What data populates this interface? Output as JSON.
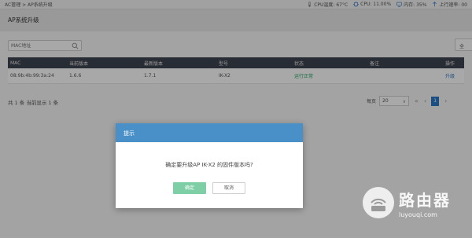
{
  "topbar": {
    "breadcrumb": "AC管理 > AP系统升级",
    "cpu_temp": "CPU温度: 67°C",
    "cpu_usage": "CPU: 11.00%",
    "memory": "内存: 35%",
    "uplink": "上行速率: 00"
  },
  "page": {
    "title": "AP系统升级"
  },
  "search": {
    "placeholder": "MAC地址"
  },
  "panel": {
    "right_button": "全"
  },
  "table": {
    "headers": [
      "MAC",
      "当前版本",
      "最新版本",
      "型号",
      "状态",
      "备注",
      "操作"
    ],
    "rows": [
      {
        "mac": "08:9b:4b:99:3a:24",
        "current": "1.6.6",
        "latest": "1.7.1",
        "model": "IK-X2",
        "status": "运行正常",
        "remark": "",
        "action": "升级"
      }
    ]
  },
  "footer": {
    "summary": "共 1 条 当前显示 1 条",
    "per_page_label": "每页",
    "per_page_value": "20",
    "current_page": "1"
  },
  "dialog": {
    "title": "提示",
    "message": "确定要升级AP IK-X2 的固件版本吗?",
    "ok_label": "确定",
    "cancel_label": "取消"
  },
  "watermark": {
    "brand": "路由器",
    "site": "luyouqi.com"
  },
  "colors": {
    "accent": "#4a90c8",
    "ok_button": "#7ecfa6",
    "status_ok": "#25a86b",
    "table_header": "#3d4350"
  }
}
